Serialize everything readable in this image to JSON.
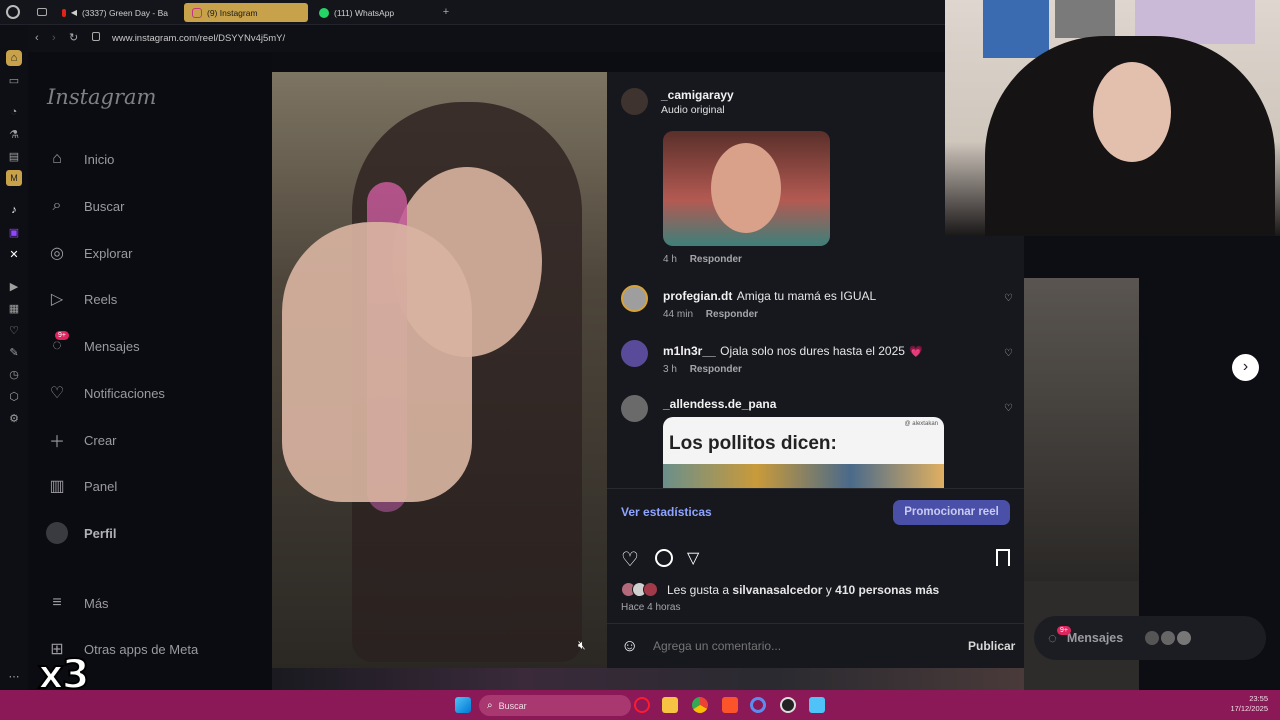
{
  "browser": {
    "tabs": [
      {
        "label": "(3337) Green Day - Ba"
      },
      {
        "label": "(9) Instagram"
      },
      {
        "label": "(111) WhatsApp"
      }
    ],
    "url": "www.instagram.com/reel/DSYYNv4j5mY/"
  },
  "instagram": {
    "logo": "Instagram",
    "nav": [
      {
        "label": "Inicio",
        "icon": "home-icon"
      },
      {
        "label": "Buscar",
        "icon": "search-icon"
      },
      {
        "label": "Explorar",
        "icon": "compass-icon"
      },
      {
        "label": "Reels",
        "icon": "reels-icon"
      },
      {
        "label": "Mensajes",
        "icon": "messenger-icon",
        "badge": "9+"
      },
      {
        "label": "Notificaciones",
        "icon": "heart-icon"
      },
      {
        "label": "Crear",
        "icon": "plus-icon"
      },
      {
        "label": "Panel",
        "icon": "chart-icon"
      },
      {
        "label": "Perfil",
        "icon": "avatar"
      }
    ],
    "more": "Más",
    "meta_apps": "Otras apps de Meta"
  },
  "post": {
    "author": "_camigarayy",
    "audio": "Audio original",
    "comments": [
      {
        "user": "",
        "text": "",
        "time": "4 h",
        "reply": "Responder"
      },
      {
        "user": "profegian.dt",
        "text": "Amiga tu mamá es IGUAL",
        "time": "44 min",
        "reply": "Responder"
      },
      {
        "user": "m1ln3r__",
        "text": "Ojala solo nos dures hasta el 2025",
        "emoji": "💗",
        "time": "3 h",
        "reply": "Responder"
      },
      {
        "user": "_allendess.de_pana",
        "image_text": "Los pollitos dicen:",
        "image_tag": "@ alextakan"
      }
    ],
    "stats_link": "Ver estadísticas",
    "promote_button": "Promocionar reel",
    "likes_prefix": "Les gusta a",
    "likes_user": "silvanasalcedor",
    "likes_connector": "y",
    "likes_others": "410 personas más",
    "time_ago": "Hace 4 horas",
    "comment_placeholder": "Agrega un comentario...",
    "publish": "Publicar"
  },
  "messages_float": {
    "label": "Mensajes",
    "badge": "9+"
  },
  "overlay_text": "x3",
  "taskbar": {
    "search": "Buscar",
    "time": "23:55",
    "date": "17/12/2025"
  },
  "colors": {
    "accent_tab": "#c8a24a",
    "promote": "#4a4fa8",
    "link": "#8fa4ff",
    "taskbar": "#8b1857",
    "badge": "#e0245e"
  }
}
